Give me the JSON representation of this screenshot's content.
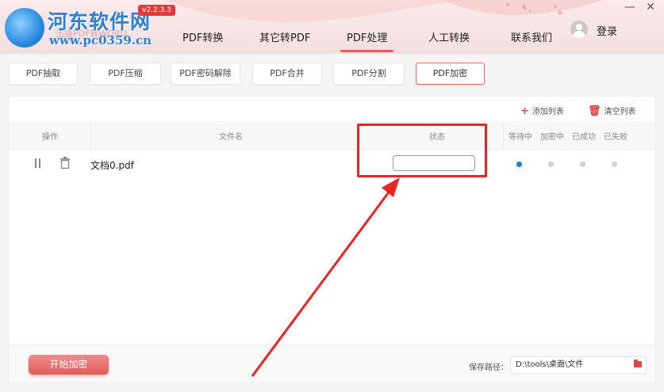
{
  "header": {
    "logo_text": "河东软件网",
    "logo_url": "www.pc0359.cn",
    "app_subtitle": "迅捷PDF转WORD",
    "version": "v2.2.3.3",
    "nav": [
      {
        "label": "PDF转换",
        "active": false
      },
      {
        "label": "其它转PDF",
        "active": false
      },
      {
        "label": "PDF处理",
        "active": true
      },
      {
        "label": "人工转换",
        "active": false
      },
      {
        "label": "联系我们",
        "active": false
      }
    ],
    "login": "登录",
    "window_minimize": "—",
    "window_close": "✕",
    "colors": {
      "accent": "#e85a5a",
      "logo": "#2e7fd6"
    }
  },
  "subtabs": [
    {
      "label": "PDF抽取",
      "active": false
    },
    {
      "label": "PDF压缩",
      "active": false
    },
    {
      "label": "PDF密码解除",
      "active": false
    },
    {
      "label": "PDF合并",
      "active": false
    },
    {
      "label": "PDF分割",
      "active": false
    },
    {
      "label": "PDF加密",
      "active": true
    }
  ],
  "toolbar": {
    "add_list": "添加列表",
    "clear_list": "清空列表",
    "add_icon": "plus-icon",
    "clear_icon": "trash-icon"
  },
  "table": {
    "columns": {
      "operation": "操作",
      "filename": "文件名",
      "status": "状态",
      "waiting": "等待中",
      "encrypting": "加密中",
      "success": "已成功",
      "failed": "已失败"
    },
    "rows": [
      {
        "filename": "文档0.pdf",
        "progress_percent": 0,
        "state": "waiting"
      }
    ]
  },
  "footer": {
    "start_button": "开始加密",
    "save_path_label": "保存路径：",
    "save_path_value": "D:\\tools\\桌面\\文件",
    "folder_icon": "folder-icon"
  },
  "annotation": {
    "color": "#ee2424",
    "target": "status-progress"
  }
}
